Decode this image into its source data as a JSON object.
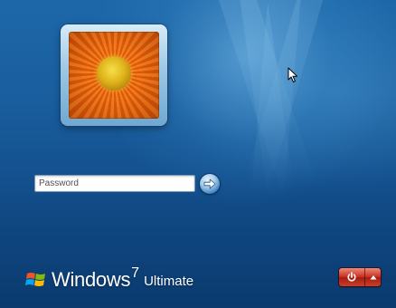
{
  "screen": {
    "name": "windows-7-logon",
    "accent_color": "#1a5f9f"
  },
  "user_tile": {
    "icon": "flower-user-picture-icon"
  },
  "password": {
    "placeholder": "Password",
    "value": ""
  },
  "submit": {
    "icon": "arrow-right-icon"
  },
  "branding": {
    "icon": "windows-flag-icon",
    "product": "Windows",
    "version": "7",
    "edition": "Ultimate"
  },
  "power": {
    "shutdown_icon": "power-icon",
    "options_icon": "triangle-up-icon",
    "color": "#c9321f"
  },
  "pointer": {
    "icon": "mouse-cursor-icon"
  }
}
